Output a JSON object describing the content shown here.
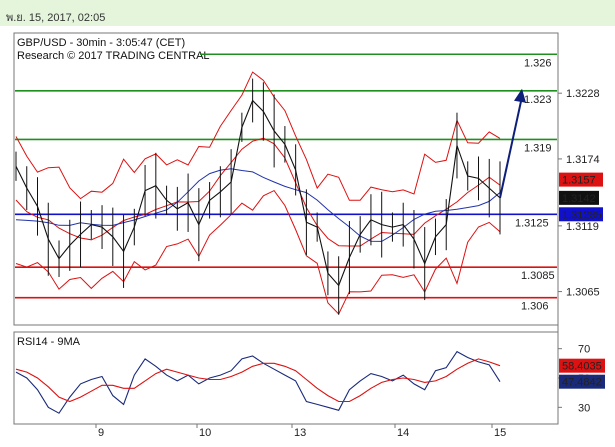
{
  "header": {
    "date": "พ.ย. 15, 2017, 02:05",
    "symbol_line": "GBP/USD - 30min - 3:05:47 (CET)",
    "research_line": "Research © 2017 TRADING CENTRAL"
  },
  "chart_data": [
    {
      "type": "line",
      "title": "GBP/USD - 30min - 3:05:47 (CET)",
      "ylim": [
        1.304,
        1.3275
      ],
      "y_ticks": [
        "1.3228",
        "1.3174",
        "1.3119",
        "1.3065"
      ],
      "x_ticks": [
        "9",
        "10",
        "13",
        "14",
        "15"
      ],
      "current_price": {
        "label": "1.3142",
        "value": 1.3142
      },
      "price_markers": [
        {
          "label": "1.3157",
          "value": 1.3157,
          "color": "#dd1111"
        },
        {
          "label": "1.31285",
          "value": 1.31285,
          "color": "#1111cc"
        }
      ],
      "resistance_levels": [
        {
          "label": "1.326",
          "value": 1.326,
          "color": "#1f8f1f"
        },
        {
          "label": "1.323",
          "value": 1.323,
          "color": "#1f8f1f"
        },
        {
          "label": "1.319",
          "value": 1.319,
          "color": "#1f8f1f"
        }
      ],
      "pivot": {
        "label": "1.3125",
        "value": 1.31285,
        "color": "#1111cc"
      },
      "support_levels": [
        {
          "label": "1.3085",
          "value": 1.3085,
          "color": "#dd1111"
        },
        {
          "label": "1.306",
          "value": 1.306,
          "color": "#dd1111"
        }
      ],
      "projection": {
        "from": 1.3142,
        "to": 1.323,
        "color": "#0d1f7a"
      },
      "price_path": [
        1.3168,
        1.315,
        1.3135,
        1.3108,
        1.3092,
        1.3103,
        1.3112,
        1.312,
        1.3118,
        1.311,
        1.3098,
        1.3118,
        1.3148,
        1.3152,
        1.314,
        1.3133,
        1.3138,
        1.312,
        1.314,
        1.3147,
        1.3155,
        1.32,
        1.3222,
        1.3213,
        1.3197,
        1.3186,
        1.3165,
        1.3122,
        1.3118,
        1.308,
        1.307,
        1.3093,
        1.3112,
        1.3124,
        1.312,
        1.3118,
        1.312,
        1.3108,
        1.3088,
        1.311,
        1.312,
        1.3185,
        1.316,
        1.3158,
        1.315,
        1.3142
      ]
    },
    {
      "type": "line",
      "title": "RSI14 - 9MA",
      "ylim": [
        20,
        80
      ],
      "y_ticks": [
        "70",
        "50",
        "30"
      ],
      "series": [
        {
          "values": [
            54,
            50,
            42,
            30,
            26,
            37,
            46,
            49,
            51,
            38,
            32,
            52,
            63,
            58,
            52,
            48,
            52,
            46,
            50,
            52,
            55,
            63,
            65,
            60,
            56,
            52,
            48,
            34,
            32,
            30,
            28,
            42,
            48,
            53,
            51,
            48,
            52,
            46,
            42,
            55,
            57,
            68,
            64,
            61,
            59,
            47.48
          ]
        },
        {
          "values": [
            56,
            54,
            50,
            44,
            37,
            34,
            37,
            41,
            45,
            45,
            43,
            43,
            48,
            53,
            56,
            54,
            52,
            50,
            49,
            49,
            51,
            54,
            58,
            60,
            60,
            58,
            55,
            49,
            43,
            38,
            34,
            34,
            38,
            43,
            47,
            49,
            50,
            49,
            47,
            48,
            51,
            56,
            60,
            63,
            61,
            58.4
          ]
        }
      ],
      "markers": [
        {
          "label": "58.4035",
          "value": 58.4035,
          "color": "#dd1111"
        },
        {
          "label": "47.4842",
          "value": 47.4842,
          "color": "#1a2a7a"
        }
      ]
    }
  ]
}
